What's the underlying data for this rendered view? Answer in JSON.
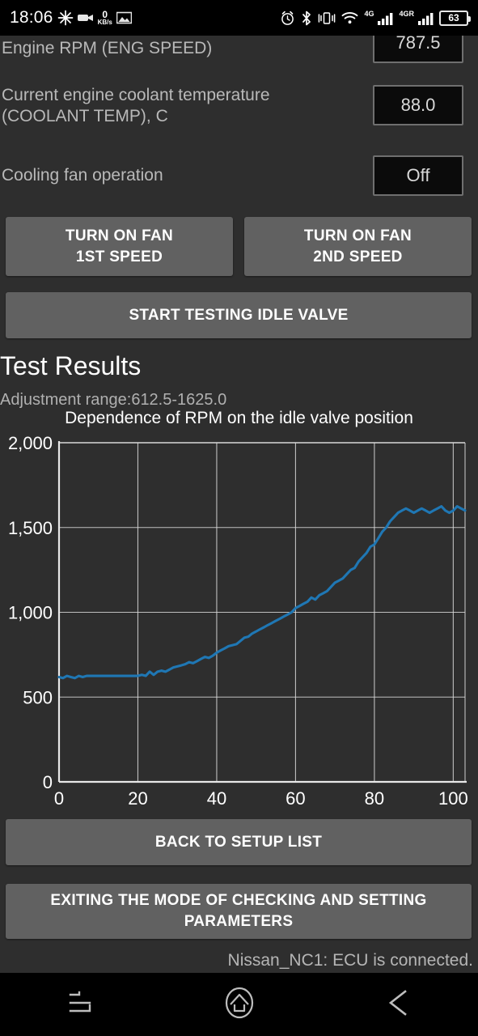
{
  "status_bar": {
    "clock": "18:06",
    "net_speed_value": "0",
    "net_speed_unit": "KB/s",
    "signal_label_1": "4G",
    "signal_label_2": "4GR",
    "battery_percent": "63",
    "icons": [
      "burst-icon",
      "camera-icon",
      "image-icon",
      "alarm-icon",
      "bluetooth-icon",
      "vibrate-icon",
      "wifi-icon",
      "signal-icon",
      "signal-icon-2",
      "battery-icon"
    ]
  },
  "params": [
    {
      "label": "Engine RPM (ENG SPEED)",
      "value": "787.5"
    },
    {
      "label": "Current engine coolant temperature (COOLANT TEMP), C",
      "value": "88.0"
    },
    {
      "label": "Cooling fan operation",
      "value": "Off"
    }
  ],
  "buttons": {
    "fan_first_speed": "TURN ON FAN\n1ST SPEED",
    "fan_first_speed_line1": "TURN ON FAN",
    "fan_first_speed_line2": "1ST SPEED",
    "fan_second_speed_line1": "TURN ON FAN",
    "fan_second_speed_line2": "2ND SPEED",
    "start_testing": "START TESTING IDLE VALVE",
    "back_to_setup": "BACK TO SETUP LIST",
    "exit_mode_line1": "EXITING THE MODE OF CHECKING AND SETTING",
    "exit_mode_line2": "PARAMETERS"
  },
  "results": {
    "title": "Test Results",
    "adjustment_range": "Adjustment range:612.5-1625.0"
  },
  "footer": {
    "connection_status": "Nissan_NC1: ECU is connected."
  },
  "navbar": {
    "recent_label": "recent-apps-icon",
    "home_label": "home-icon",
    "back_label": "back-icon"
  },
  "colors": {
    "background": "#2e2e2e",
    "button": "#616161",
    "line": "#1f77b4",
    "grid": "#d9d9d9",
    "text": "#ffffff"
  },
  "chart_data": {
    "type": "line",
    "title": "Dependence of RPM on the idle valve position",
    "xlabel": "",
    "ylabel": "",
    "xlim": [
      0,
      103
    ],
    "ylim": [
      0,
      2000
    ],
    "xticks": [
      0,
      20,
      40,
      60,
      80,
      100
    ],
    "xtick_labels": [
      "0",
      "20",
      "40",
      "60",
      "80",
      "100"
    ],
    "yticks": [
      0,
      500,
      1000,
      1500,
      2000
    ],
    "ytick_labels": [
      "0",
      "500",
      "1,000",
      "1,500",
      "2,000"
    ],
    "grid": true,
    "legend": "none",
    "series": [
      {
        "name": "RPM",
        "x": [
          0,
          1,
          2,
          3,
          4,
          5,
          6,
          7,
          8,
          9,
          10,
          11,
          12,
          13,
          14,
          15,
          16,
          17,
          18,
          19,
          20,
          21,
          22,
          23,
          24,
          25,
          26,
          27,
          28,
          29,
          30,
          31,
          32,
          33,
          34,
          35,
          36,
          37,
          38,
          39,
          40,
          41,
          42,
          43,
          44,
          45,
          46,
          47,
          48,
          49,
          50,
          51,
          52,
          53,
          54,
          55,
          56,
          57,
          58,
          59,
          60,
          61,
          62,
          63,
          64,
          65,
          66,
          67,
          68,
          69,
          70,
          71,
          72,
          73,
          74,
          75,
          76,
          77,
          78,
          79,
          80,
          81,
          82,
          83,
          84,
          85,
          86,
          87,
          88,
          89,
          90,
          91,
          92,
          93,
          94,
          95,
          96,
          97,
          98,
          99,
          100,
          101,
          102,
          103
        ],
        "y": [
          618,
          612,
          625,
          618,
          612,
          625,
          618,
          625,
          625,
          625,
          625,
          625,
          625,
          625,
          625,
          625,
          625,
          625,
          625,
          625,
          625,
          631,
          625,
          650,
          631,
          650,
          656,
          650,
          662,
          675,
          681,
          687,
          694,
          706,
          700,
          712,
          725,
          737,
          731,
          744,
          762,
          775,
          787,
          800,
          806,
          812,
          831,
          850,
          856,
          875,
          887,
          900,
          912,
          925,
          937,
          950,
          962,
          975,
          987,
          1000,
          1025,
          1037,
          1050,
          1062,
          1087,
          1075,
          1100,
          1112,
          1125,
          1150,
          1175,
          1187,
          1200,
          1225,
          1250,
          1262,
          1300,
          1325,
          1350,
          1387,
          1400,
          1437,
          1475,
          1500,
          1537,
          1562,
          1587,
          1600,
          1612,
          1600,
          1587,
          1600,
          1612,
          1600,
          1587,
          1600,
          1612,
          1625,
          1600,
          1587,
          1600,
          1625,
          1612,
          1600,
          1612,
          1625
        ]
      }
    ]
  }
}
